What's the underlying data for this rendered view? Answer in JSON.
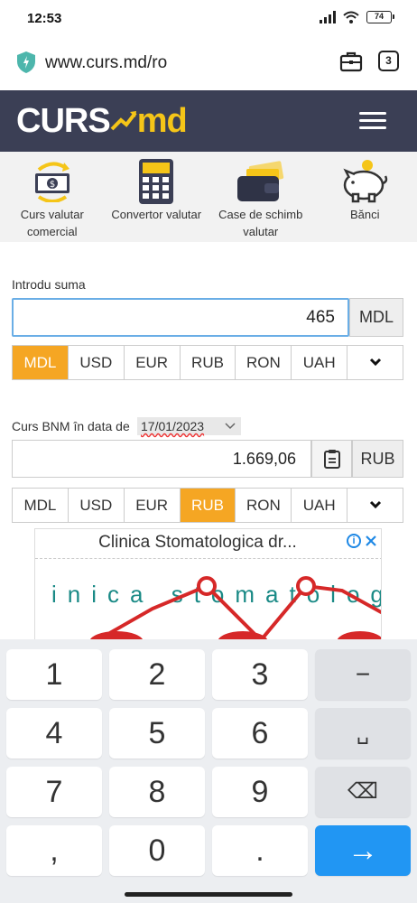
{
  "status": {
    "time": "12:53",
    "battery": "74"
  },
  "browser": {
    "url": "www.curs.md/ro",
    "tab_count": "3"
  },
  "header": {
    "logo_left": "CURS",
    "logo_right": "md"
  },
  "nav": {
    "items": [
      {
        "label": "Curs valutar comercial"
      },
      {
        "label": "Convertor valutar"
      },
      {
        "label": "Case de schimb valutar"
      },
      {
        "label": "Bănci"
      }
    ]
  },
  "converter": {
    "amount_label": "Introdu suma",
    "amount_value": "465",
    "amount_unit": "MDL",
    "source_currencies": [
      "MDL",
      "USD",
      "EUR",
      "RUB",
      "RON",
      "UAH"
    ],
    "source_selected": "MDL",
    "rate_label": "Curs BNM în data de",
    "rate_date": "17/01/2023",
    "result_value": "1.669,06",
    "result_unit": "RUB",
    "target_currencies": [
      "MDL",
      "USD",
      "EUR",
      "RUB",
      "RON",
      "UAH"
    ],
    "target_selected": "RUB"
  },
  "ad": {
    "title": "Clinica Stomatologica dr...",
    "banner_text": "inica stomatolog"
  },
  "keyboard": {
    "keys": [
      "1",
      "2",
      "3",
      "−",
      "4",
      "5",
      "6",
      "␣",
      "7",
      "8",
      "9",
      "⌫",
      ",",
      "0",
      ".",
      "→"
    ]
  },
  "colors": {
    "header": "#3b3f55",
    "accent": "#f5a623",
    "logo_yellow": "#f5c518",
    "enter_key": "#2196f3"
  }
}
